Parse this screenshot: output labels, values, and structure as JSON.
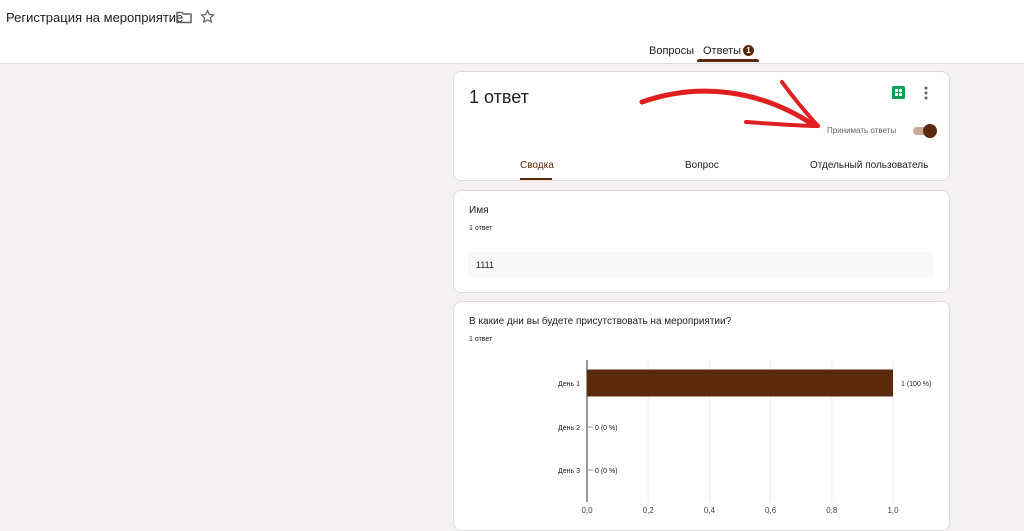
{
  "header": {
    "title": "Регистрация на мероприятие",
    "tabs": [
      {
        "label": "Вопросы"
      },
      {
        "label": "Ответы",
        "badge": "1"
      }
    ]
  },
  "summary": {
    "count_label": "1 ответ",
    "accept_label": "Принимать ответы",
    "accepting": true,
    "subtabs": [
      {
        "label": "Сводка"
      },
      {
        "label": "Вопрос"
      },
      {
        "label": "Отдельный пользователь"
      }
    ]
  },
  "questions": [
    {
      "title": "Имя",
      "count": "1 ответ",
      "answers": [
        "1111"
      ]
    },
    {
      "title": "В какие дни вы будете присутствовать на мероприятии?",
      "count": "1 ответ"
    }
  ],
  "colors": {
    "accent": "#5b2a0c",
    "annotation": "#e02020"
  },
  "chart_data": {
    "type": "bar",
    "orientation": "horizontal",
    "categories": [
      "День 1",
      "День 2",
      "День 3"
    ],
    "values": [
      1,
      0,
      0
    ],
    "data_labels": [
      "1 (100 %)",
      "0 (0 %)",
      "0 (0 %)"
    ],
    "xticks": [
      "0,0",
      "0,2",
      "0,4",
      "0,6",
      "0,8",
      "1,0"
    ],
    "xlim": [
      0,
      1
    ],
    "grid": true
  }
}
